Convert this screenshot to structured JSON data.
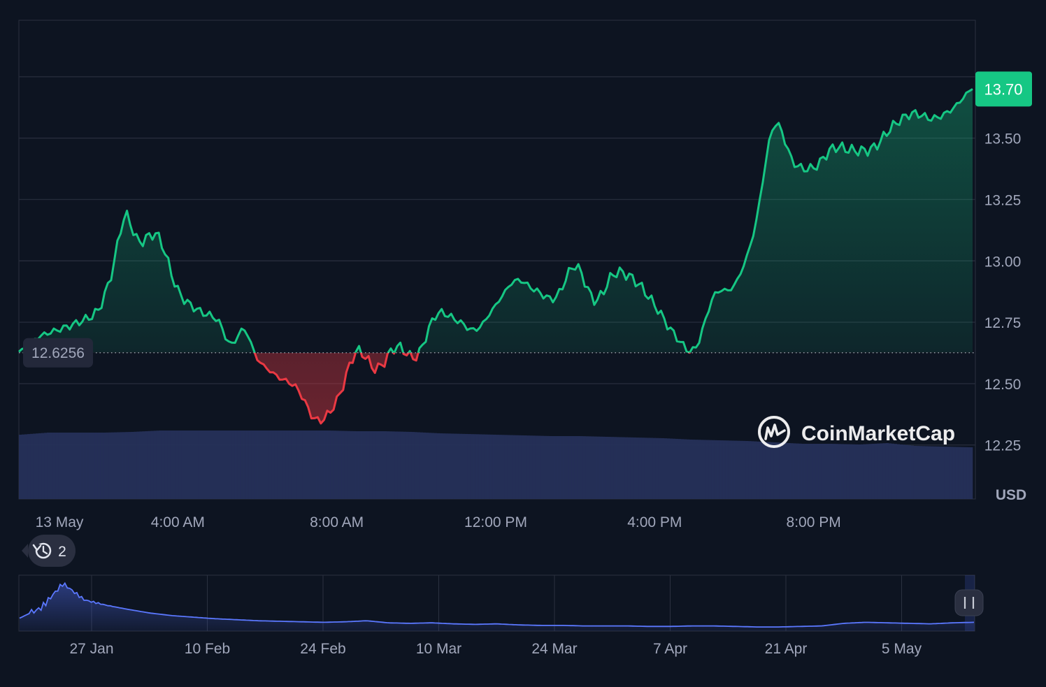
{
  "chart_data": {
    "type": "line",
    "currency": "USD",
    "reference_value": 12.6256,
    "reference_label": "12.6256",
    "current_value": 13.7,
    "current_label": "13.70",
    "y_ticks": [
      "12.25",
      "12.50",
      "12.75",
      "13.00",
      "13.25",
      "13.50"
    ],
    "x_ticks": [
      "13 May",
      "4:00 AM",
      "8:00 AM",
      "12:00 PM",
      "4:00 PM",
      "8:00 PM"
    ],
    "x_range": [
      "00:00",
      "24:00"
    ],
    "ylim": [
      12.03,
      13.98
    ],
    "up_color": "#16c784",
    "down_color": "#ea3943",
    "price_series": {
      "name": "Price",
      "times": [
        "00:00",
        "00:30",
        "01:00",
        "01:30",
        "02:00",
        "02:20",
        "02:40",
        "03:00",
        "03:30",
        "04:00",
        "04:30",
        "05:00",
        "05:20",
        "05:40",
        "06:00",
        "06:30",
        "07:00",
        "07:30",
        "08:00",
        "08:30",
        "09:00",
        "09:30",
        "10:00",
        "10:30",
        "11:00",
        "11:30",
        "12:00",
        "12:30",
        "13:00",
        "13:30",
        "14:00",
        "14:30",
        "15:00",
        "15:30",
        "16:00",
        "16:30",
        "17:00",
        "17:30",
        "18:00",
        "18:30",
        "19:00",
        "19:30",
        "20:00",
        "20:30",
        "21:00",
        "21:30",
        "22:00",
        "22:30",
        "23:00",
        "23:30",
        "24:00"
      ],
      "values": [
        12.63,
        12.69,
        12.72,
        12.75,
        12.8,
        12.95,
        13.18,
        13.08,
        13.1,
        12.88,
        12.8,
        12.76,
        12.66,
        12.72,
        12.6,
        12.53,
        12.48,
        12.35,
        12.43,
        12.63,
        12.56,
        12.65,
        12.61,
        12.78,
        12.76,
        12.72,
        12.82,
        12.92,
        12.88,
        12.85,
        12.98,
        12.84,
        12.95,
        12.92,
        12.82,
        12.7,
        12.64,
        12.86,
        12.9,
        13.12,
        13.55,
        13.4,
        13.38,
        13.46,
        13.45,
        13.46,
        13.55,
        13.6,
        13.58,
        13.62,
        13.7
      ]
    },
    "volume_series": {
      "name": "Volume",
      "values": [
        0.92,
        0.95,
        0.95,
        0.95,
        0.96,
        0.98,
        0.98,
        0.98,
        0.98,
        0.98,
        0.98,
        0.98,
        0.97,
        0.97,
        0.96,
        0.94,
        0.93,
        0.92,
        0.91,
        0.9,
        0.9,
        0.89,
        0.88,
        0.87,
        0.85,
        0.84,
        0.83,
        0.81,
        0.79,
        0.79,
        0.78,
        0.8,
        0.76,
        0.75,
        0.74
      ]
    },
    "history_count": "2",
    "overview": {
      "x_ticks": [
        "27 Jan",
        "10 Feb",
        "24 Feb",
        "10 Mar",
        "24 Mar",
        "7 Apr",
        "21 Apr",
        "5 May"
      ],
      "values": [
        0.25,
        0.45,
        0.92,
        0.6,
        0.5,
        0.42,
        0.35,
        0.3,
        0.27,
        0.24,
        0.22,
        0.2,
        0.19,
        0.18,
        0.17,
        0.18,
        0.2,
        0.16,
        0.15,
        0.16,
        0.14,
        0.13,
        0.14,
        0.12,
        0.11,
        0.11,
        0.1,
        0.1,
        0.1,
        0.09,
        0.09,
        0.1,
        0.1,
        0.09,
        0.08,
        0.08,
        0.09,
        0.1,
        0.15,
        0.17,
        0.16,
        0.15,
        0.14,
        0.16,
        0.17
      ]
    }
  },
  "branding": {
    "name": "CoinMarketCap"
  }
}
